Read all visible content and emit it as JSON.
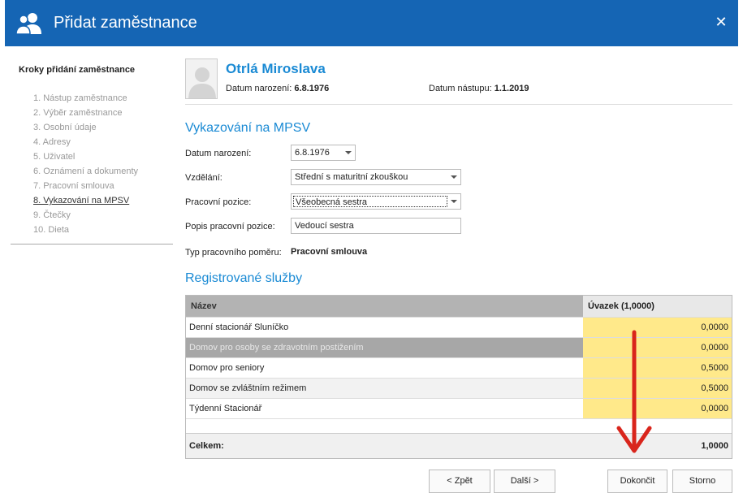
{
  "window": {
    "title": "Přidat zaměstnance",
    "close_symbol": "✕"
  },
  "steps": {
    "title": "Kroky přidání zaměstnance",
    "items": [
      "1. Nástup zaměstnance",
      "2. Výběr zaměstnance",
      "3. Osobní údaje",
      "4. Adresy",
      "5. Uživatel",
      "6. Oznámení a dokumenty",
      "7. Pracovní smlouva",
      "8. Vykazování na MPSV",
      "9. Čtečky",
      "10. Dieta"
    ],
    "active_index": 7
  },
  "employee": {
    "name": "Otrlá Miroslava",
    "birth_label": "Datum narození:",
    "birth_value": "6.8.1976",
    "start_label": "Datum nástupu:",
    "start_value": "1.1.2019"
  },
  "mpsv": {
    "title": "Vykazování na MPSV",
    "birth_label": "Datum narození:",
    "birth_value": "6.8.1976",
    "education_label": "Vzdělání:",
    "education_value": "Střední s maturitní zkouškou",
    "position_label": "Pracovní pozice:",
    "position_value": "Všeobecná sestra",
    "position_desc_label": "Popis pracovní pozice:",
    "position_desc_value": "Vedoucí sestra",
    "contract_type_label": "Typ pracovního poměru:",
    "contract_type_value": "Pracovní smlouva"
  },
  "services": {
    "title": "Registrované služby",
    "col_name": "Název",
    "col_load": "Úvazek (1,0000)",
    "rows": [
      {
        "name": "Denní stacionář Sluníčko",
        "load": "0,0000"
      },
      {
        "name": "Domov pro osoby se zdravotním postižením",
        "load": "0,0000"
      },
      {
        "name": "Domov pro seniory",
        "load": "0,5000"
      },
      {
        "name": "Domov se zvláštním režimem",
        "load": "0,5000"
      },
      {
        "name": "Týdenní Stacionář",
        "load": "0,0000"
      }
    ],
    "total_label": "Celkem:",
    "total_value": "1,0000"
  },
  "buttons": {
    "back": "< Zpět",
    "next": "Další >",
    "finish": "Dokončit",
    "cancel": "Storno"
  },
  "colors": {
    "header": "#1565b4",
    "accent": "#1a8ad4",
    "load_cell": "#ffe98a",
    "annotation": "#d9251c"
  }
}
